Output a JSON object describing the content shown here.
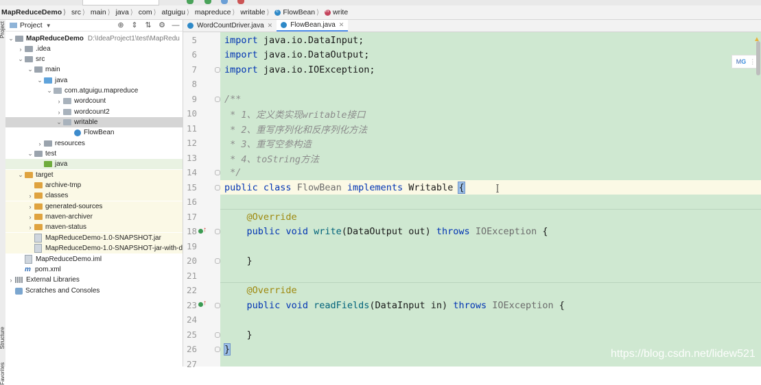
{
  "breadcrumb": {
    "items": [
      "MapReduceDemo",
      "src",
      "main",
      "java",
      "com",
      "atguigu",
      "mapreduce",
      "writable",
      "FlowBean",
      "write"
    ],
    "separator": "⟩"
  },
  "toolstrip": {
    "project_label": "Project",
    "structure_label": "Structure",
    "favorites_label": "Favorites"
  },
  "panel": {
    "title": "Project",
    "tree": [
      {
        "label": "MapReduceDemo",
        "path": "D:\\IdeaProject1\\test\\MapRedu"
      },
      {
        "label": ".idea"
      },
      {
        "label": "src"
      },
      {
        "label": "main"
      },
      {
        "label": "java"
      },
      {
        "label": "com.atguigu.mapreduce"
      },
      {
        "label": "wordcount"
      },
      {
        "label": "wordcount2"
      },
      {
        "label": "writable"
      },
      {
        "label": "FlowBean"
      },
      {
        "label": "resources"
      },
      {
        "label": "test"
      },
      {
        "label": "java"
      },
      {
        "label": "target"
      },
      {
        "label": "archive-tmp"
      },
      {
        "label": "classes"
      },
      {
        "label": "generated-sources"
      },
      {
        "label": "maven-archiver"
      },
      {
        "label": "maven-status"
      },
      {
        "label": "MapReduceDemo-1.0-SNAPSHOT.jar"
      },
      {
        "label": "MapReduceDemo-1.0-SNAPSHOT-jar-with-d"
      },
      {
        "label": "MapReduceDemo.iml"
      },
      {
        "label": "pom.xml"
      },
      {
        "label": "External Libraries"
      },
      {
        "label": "Scratches and Consoles"
      }
    ]
  },
  "tabs": [
    {
      "label": "WordCountDriver.java",
      "active": false
    },
    {
      "label": "FlowBean.java",
      "active": true
    }
  ],
  "code": {
    "line_numbers": [
      "5",
      "6",
      "7",
      "8",
      "9",
      "10",
      "11",
      "12",
      "13",
      "14",
      "15",
      "16",
      "17",
      "18",
      "19",
      "20",
      "21",
      "22",
      "23",
      "24",
      "25",
      "26",
      "27"
    ],
    "t": {
      "import": "import",
      "imp1": " java.io.DataInput;",
      "imp2": " java.io.DataOutput;",
      "imp3": " java.io.IOException;",
      "c9": "/**",
      "c10": " * 1、定义类实现writable接口",
      "c11": " * 2、重写序列化和反序列化方法",
      "c12": " * 3、重写空参构造",
      "c13": " * 4、toString方法",
      "c14": " */",
      "public": "public",
      "class": "class",
      "FlowBean": "FlowBean",
      "implements": "implements",
      "Writable": "Writable",
      "open_brace": "{",
      "override": "@Override",
      "void": "void",
      "write": "write",
      "write_params": "(DataOutput out)",
      "throws": "throws",
      "IOException": "IOException",
      "readFields": "readFields",
      "read_params": "(DataInput in)",
      "close_brace": "}",
      "indent": "    ",
      "sp": " "
    }
  },
  "colors": {
    "code_background": "#cfe8d1",
    "keyword": "#0033b3",
    "annotation": "#9e880d",
    "tab_underline": "#4c8ee8"
  },
  "watermark": "https://blog.csdn.net/lidew521"
}
